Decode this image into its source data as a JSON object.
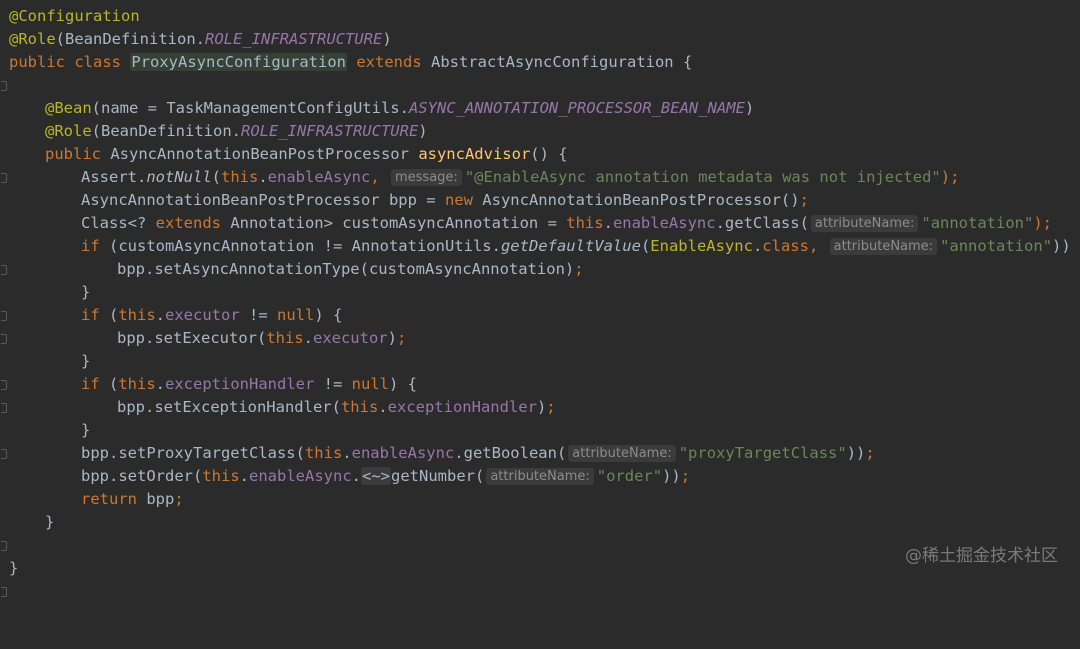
{
  "code": {
    "l1_annotation": "@Configuration",
    "l2_annotation": "@Role",
    "l2_paren_open": "(",
    "l2_class": "BeanDefinition.",
    "l2_const": "ROLE_INFRASTRUCTURE",
    "l2_paren_close": ")",
    "l3_public": "public",
    "l3_class_kw": "class",
    "l3_name": "ProxyAsyncConfiguration",
    "l3_extends": "extends",
    "l3_super": "AbstractAsyncConfiguration {",
    "l5_annotation": "@Bean",
    "l5_rest1": "(name = TaskManagementConfigUtils.",
    "l5_const": "ASYNC_ANNOTATION_PROCESSOR_BEAN_NAME",
    "l5_rest2": ")",
    "l6_annotation": "@Role",
    "l6_rest1": "(BeanDefinition.",
    "l6_const": "ROLE_INFRASTRUCTURE",
    "l6_rest2": ")",
    "l7_public": "public",
    "l7_type": "AsyncAnnotationBeanPostProcessor",
    "l7_method": "asyncAdvisor",
    "l7_rest": "() {",
    "l8_assert": "Assert.",
    "l8_notnull": "notNull",
    "l8_paren": "(",
    "l8_this": "this",
    "l8_dot": ".",
    "l8_field": "enableAsync",
    "l8_comma": ", ",
    "l8_hint": "message:",
    "l8_str": "\"@EnableAsync annotation metadata was not injected\"",
    "l8_end": ");",
    "l9_decl": "AsyncAnnotationBeanPostProcessor bpp = ",
    "l9_new": "new",
    "l9_rest": " AsyncAnnotationBeanPostProcessor()",
    "l9_semi": ";",
    "l10_a": "Class<? ",
    "l10_extends": "extends",
    "l10_b": " Annotation> customAsyncAnnotation = ",
    "l10_this": "this",
    "l10_dot": ".",
    "l10_field": "enableAsync",
    "l10_c": ".getClass(",
    "l10_hint": "attributeName:",
    "l10_str": "\"annotation\"",
    "l10_end": ");",
    "l11_if": "if",
    "l11_a": " (customAsyncAnnotation != AnnotationUtils.",
    "l11_method": "getDefaultValue",
    "l11_b": "(",
    "l11_cls": "EnableAsync",
    "l11_dot": ".",
    "l11_class": "class",
    "l11_comma": ", ",
    "l11_hint": "attributeName:",
    "l11_str": "\"annotation\"",
    "l11_end": ")) {",
    "l12_a": "bpp.setAsyncAnnotationType(customAsyncAnnotation)",
    "l12_semi": ";",
    "l13": "}",
    "l14_if": "if",
    "l14_a": " (",
    "l14_this": "this",
    "l14_dot": ".",
    "l14_field": "executor",
    "l14_b": " != ",
    "l14_null": "null",
    "l14_c": ") {",
    "l15_a": "bpp.setExecutor(",
    "l15_this": "this",
    "l15_dot": ".",
    "l15_field": "executor",
    "l15_b": ")",
    "l15_semi": ";",
    "l16": "}",
    "l17_if": "if",
    "l17_a": " (",
    "l17_this": "this",
    "l17_dot": ".",
    "l17_field": "exceptionHandler",
    "l17_b": " != ",
    "l17_null": "null",
    "l17_c": ") {",
    "l18_a": "bpp.setExceptionHandler(",
    "l18_this": "this",
    "l18_dot": ".",
    "l18_field": "exceptionHandler",
    "l18_b": ")",
    "l18_semi": ";",
    "l19": "}",
    "l20_a": "bpp.setProxyTargetClass(",
    "l20_this": "this",
    "l20_dot": ".",
    "l20_field": "enableAsync",
    "l20_b": ".getBoolean(",
    "l20_hint": "attributeName:",
    "l20_str": "\"proxyTargetClass\"",
    "l20_end": "))",
    "l20_semi": ";",
    "l21_a": "bpp.setOrder(",
    "l21_this": "this",
    "l21_dot": ".",
    "l21_field": "enableAsync",
    "l21_dot2": ".",
    "l21_diamond": "<~>",
    "l21_b": "getNumber(",
    "l21_hint": "attributeName:",
    "l21_str": "\"order\"",
    "l21_end": "))",
    "l21_semi": ";",
    "l22_return": "return",
    "l22_rest": " bpp",
    "l22_semi": ";",
    "l23": "}",
    "l25": "}"
  },
  "watermark": "@稀土掘金技术社区",
  "colors": {
    "background": "#2b2b2b",
    "keyword": "#cc7832",
    "annotation": "#bbb529",
    "field": "#9876aa",
    "string": "#6a8759",
    "method": "#ffc66d",
    "default": "#a9b7c6"
  }
}
